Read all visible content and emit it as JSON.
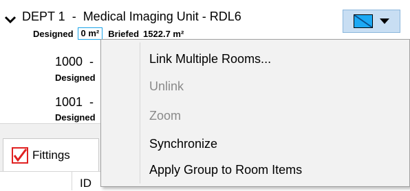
{
  "department": {
    "title": "DEPT 1  -  Medical Imaging Unit - RDL6",
    "designed_label": "Designed",
    "designed_value": "0 m²",
    "briefed_label": "Briefed",
    "briefed_value": "1522.7 m²"
  },
  "color_button": {
    "swatch_colors": [
      "#1ca9f4",
      "#0b4f8a"
    ],
    "icon": "chevron-down-icon"
  },
  "rooms": [
    {
      "number": "1000  -",
      "designed_label": "Designed"
    },
    {
      "number": "1001  -",
      "designed_label": "Designed"
    }
  ],
  "tabs": {
    "fittings_label": "Fittings",
    "checkbox_color": "#e02020"
  },
  "grid": {
    "header_partial": "ID"
  },
  "context_menu": {
    "items": [
      {
        "label": "Link Multiple Rooms...",
        "enabled": true
      },
      {
        "label": "Unlink",
        "enabled": false
      },
      {
        "label": "Zoom",
        "enabled": false
      },
      {
        "label": "Synchronize",
        "enabled": true
      },
      {
        "label": "Apply Group to Room Items",
        "enabled": true
      }
    ]
  }
}
